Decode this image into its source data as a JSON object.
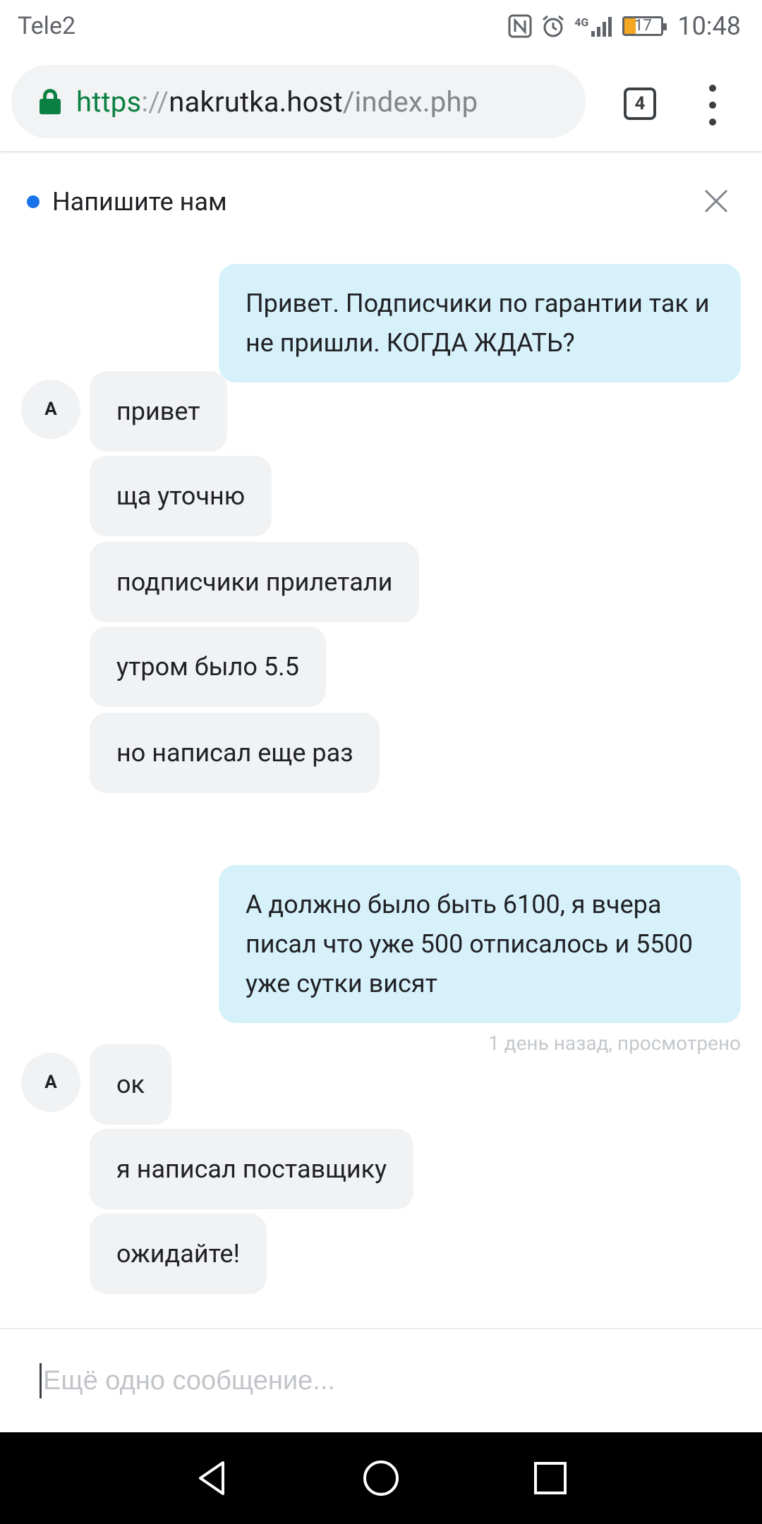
{
  "status_bar": {
    "carrier": "Tele2",
    "network": "4G",
    "battery": "17",
    "time": "10:48"
  },
  "browser": {
    "url_scheme": "https",
    "url_separator": "://",
    "url_host": "nakrutka.host",
    "url_path": "/index.php",
    "tab_count": "4"
  },
  "chat": {
    "title": "Напишите нам",
    "status_color": "#1a73e8",
    "outgoing_bubble_color": "#d7f1fb",
    "incoming_bubble_color": "#f1f2f4",
    "messages": [
      {
        "direction": "out",
        "text": "Привет. Подписчики по гарантии так и не пришли. КОГДА ЖДАТЬ?"
      },
      {
        "direction": "in",
        "avatar": "A",
        "text": "привет"
      },
      {
        "direction": "in",
        "text": "ща уточню"
      },
      {
        "direction": "in",
        "text": "подписчики прилетали"
      },
      {
        "direction": "in",
        "text": "утром было 5.5"
      },
      {
        "direction": "in",
        "text": "но написал еще раз"
      },
      {
        "direction": "out",
        "text": "А должно было быть 6100, я вчера писал что уже 500 отписалось и 5500 уже сутки висят"
      },
      {
        "direction": "in",
        "avatar": "A",
        "text": "ок"
      },
      {
        "direction": "in",
        "text": "я написал поставщику"
      },
      {
        "direction": "in",
        "text": "ожидайте!"
      }
    ],
    "seen_status": "1 день назад, просмотрено",
    "composer_placeholder": "Ещё одно сообщение..."
  }
}
